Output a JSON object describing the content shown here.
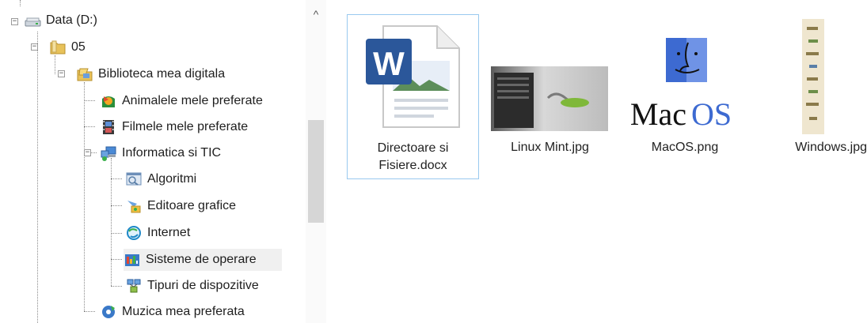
{
  "tree": {
    "items": [
      {
        "label": "Data (D:)",
        "icon": "drive-icon"
      },
      {
        "label": "05",
        "icon": "folder-icon"
      },
      {
        "label": "Biblioteca mea digitala",
        "icon": "library-folder-icon"
      },
      {
        "label": "Animalele mele preferate",
        "icon": "animals-folder-icon"
      },
      {
        "label": "Filmele mele preferate",
        "icon": "film-folder-icon"
      },
      {
        "label": "Informatica si TIC",
        "icon": "computer-folder-icon"
      },
      {
        "label": "Algoritmi",
        "icon": "algorithm-folder-icon"
      },
      {
        "label": "Editoare grafice",
        "icon": "graphics-folder-icon"
      },
      {
        "label": "Internet",
        "icon": "internet-folder-icon"
      },
      {
        "label": "Sisteme de operare",
        "icon": "os-folder-icon"
      },
      {
        "label": "Tipuri de dispozitive",
        "icon": "devices-folder-icon"
      },
      {
        "label": "Muzica mea preferata",
        "icon": "music-folder-icon"
      }
    ],
    "expand_glyph": "−"
  },
  "scrollbar": {
    "up_arrow": "^"
  },
  "files": [
    {
      "name": "Directoare si Fisiere.docx",
      "icon": "word-document-icon"
    },
    {
      "name": "Linux Mint.jpg",
      "icon": "linux-mint-thumbnail"
    },
    {
      "name": "MacOS.png",
      "icon": "macos-thumbnail"
    },
    {
      "name": "Windows.jpg",
      "icon": "windows-thumbnail"
    }
  ],
  "macos_logo": {
    "mac": "Mac",
    "os": "OS"
  },
  "colors": {
    "selection_border": "#99c9ef",
    "word_blue": "#2b579a",
    "mac_blue": "#3d6ad1",
    "folder_yellow": "#e8c25a"
  }
}
